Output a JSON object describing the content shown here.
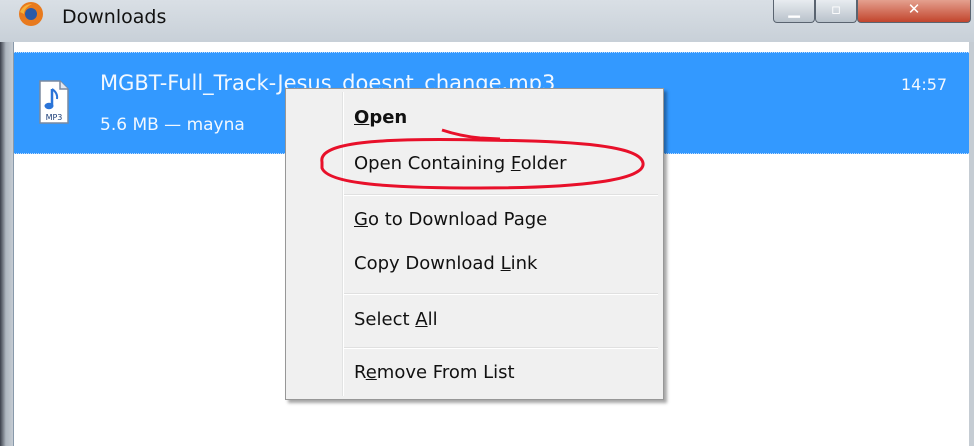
{
  "window": {
    "title": "Downloads",
    "icon": "firefox-icon"
  },
  "download": {
    "file_name": "MGBT-Full_Track-Jesus_doesnt_change.mp3",
    "meta": "5.6 MB — mayna",
    "time": "14:57",
    "icon": "mp3-file-icon",
    "icon_label": "MP3"
  },
  "context_menu": {
    "items": [
      {
        "pre": "",
        "key": "O",
        "post": "pen",
        "bold": true
      },
      {
        "pre": "Open Containing ",
        "key": "F",
        "post": "older",
        "highlighted_by_annotation": true
      },
      {
        "pre": "",
        "key": "G",
        "post": "o to Download Page"
      },
      {
        "pre": "Copy Download ",
        "key": "L",
        "post": "ink"
      },
      {
        "pre": "Select ",
        "key": "A",
        "post": "ll"
      },
      {
        "pre": "R",
        "key": "e",
        "post": "move From List"
      }
    ]
  },
  "colors": {
    "selection": "#3399ff",
    "annotation": "#e8102a",
    "menu_bg": "#f0f0f0"
  }
}
